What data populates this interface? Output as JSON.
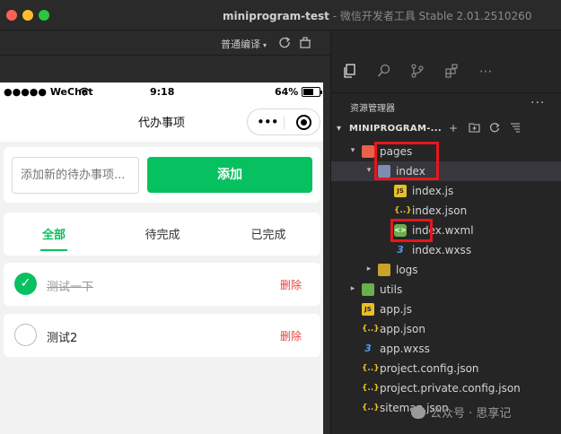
{
  "window": {
    "title_main": "miniprogram-test",
    "title_rest": " - 微信开发者工具 Stable 2.01.2510260"
  },
  "toolbar": {
    "compile_mode": "普通编译",
    "caret": "▾"
  },
  "status_bar": {
    "carrier": "●●●●● WeChat",
    "time": "9:18",
    "battery": "64%",
    "battery_level": 0.64
  },
  "nav": {
    "title": "代办事项",
    "capsule_dots": "•••"
  },
  "add_form": {
    "placeholder": "添加新的待办事项...",
    "button_label": "添加"
  },
  "tabs": [
    {
      "label": "全部",
      "active": true
    },
    {
      "label": "待完成",
      "active": false
    },
    {
      "label": "已完成",
      "active": false
    }
  ],
  "todos": [
    {
      "text": "测试一下",
      "done": true,
      "check_glyph": "✓",
      "delete_label": "删除"
    },
    {
      "text": "测试2",
      "done": false,
      "check_glyph": "",
      "delete_label": "删除"
    }
  ],
  "explorer": {
    "title": "资源管理器",
    "more": "···",
    "project_name": "MINIPROGRAM-...",
    "tree": [
      {
        "label": "pages",
        "caret": "▾",
        "icon": "folder-pages-icon",
        "selected": false
      },
      {
        "label": "index",
        "caret": "▾",
        "icon": "folder-index-icon",
        "selected": true
      },
      {
        "label": "index.js",
        "caret": "",
        "icon": "js-file-icon",
        "icon_text": "JS",
        "selected": false
      },
      {
        "label": "index.json",
        "caret": "",
        "icon": "json-file-icon",
        "icon_text": "{..}",
        "selected": false
      },
      {
        "label": "index.wxml",
        "caret": "",
        "icon": "wxml-file-icon",
        "icon_text": "<>",
        "selected": false
      },
      {
        "label": "index.wxss",
        "caret": "",
        "icon": "wxss-file-icon",
        "icon_text": "3",
        "selected": false
      },
      {
        "label": "logs",
        "caret": "▸",
        "icon": "folder-logs-icon",
        "selected": false
      },
      {
        "label": "utils",
        "caret": "▸",
        "icon": "folder-utils-icon",
        "selected": false
      },
      {
        "label": "app.js",
        "caret": "",
        "icon": "js-file-icon",
        "icon_text": "JS",
        "selected": false
      },
      {
        "label": "app.json",
        "caret": "",
        "icon": "json-file-icon",
        "icon_text": "{..}",
        "selected": false
      },
      {
        "label": "app.wxss",
        "caret": "",
        "icon": "wxss-file-icon",
        "icon_text": "3",
        "selected": false
      },
      {
        "label": "project.config.json",
        "caret": "",
        "icon": "json-file-icon",
        "icon_text": "{..}",
        "selected": false
      },
      {
        "label": "project.private.config.json",
        "caret": "",
        "icon": "json-file-icon",
        "icon_text": "{..}",
        "selected": false
      },
      {
        "label": "sitemap.json",
        "caret": "",
        "icon": "json-file-icon",
        "icon_text": "{..}",
        "selected": false
      }
    ]
  },
  "watermark": "公众号 · 思享记",
  "colors": {
    "accent_green": "#07c160",
    "delete_red": "#e64340",
    "highlight_red": "#e8161d"
  }
}
